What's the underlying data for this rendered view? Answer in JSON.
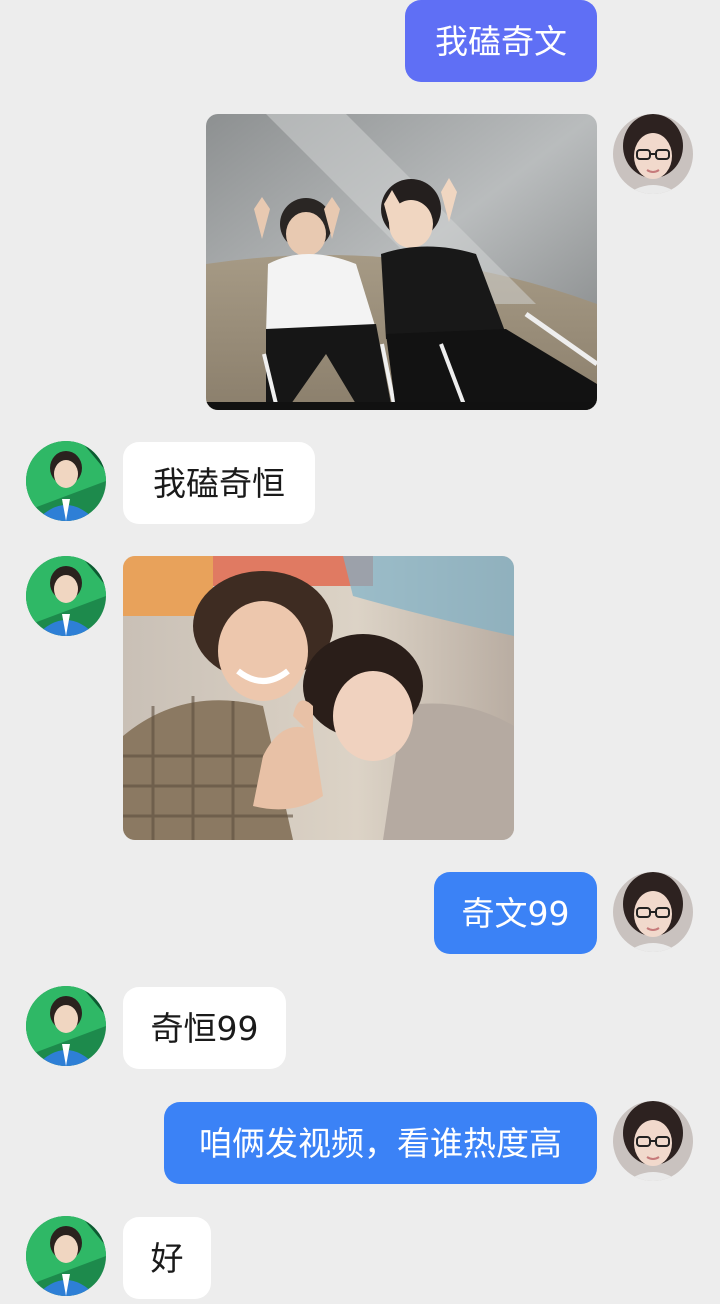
{
  "chat": {
    "messages": [
      {
        "side": "out",
        "type": "text",
        "text": "我磕奇文"
      },
      {
        "side": "out",
        "type": "image",
        "avatar": "girl-glasses-avatar"
      },
      {
        "side": "in",
        "type": "text",
        "text": "我磕奇恒",
        "avatar": "boy-blue-avatar"
      },
      {
        "side": "in",
        "type": "image",
        "avatar": "boy-blue-avatar"
      },
      {
        "side": "out",
        "type": "text",
        "text": "奇文99",
        "avatar": "girl-glasses-avatar"
      },
      {
        "side": "in",
        "type": "text",
        "text": "奇恒99",
        "avatar": "boy-blue-avatar"
      },
      {
        "side": "out",
        "type": "text",
        "text": "咱俩发视频，看谁热度高",
        "avatar": "girl-glasses-avatar"
      },
      {
        "side": "in",
        "type": "text",
        "text": "好",
        "avatar": "boy-blue-avatar"
      }
    ]
  },
  "colors": {
    "background": "#ededed",
    "outgoing_bubble": "#3b82f6",
    "outgoing_bubble_first": "#5f6ff5",
    "incoming_bubble": "#ffffff"
  }
}
